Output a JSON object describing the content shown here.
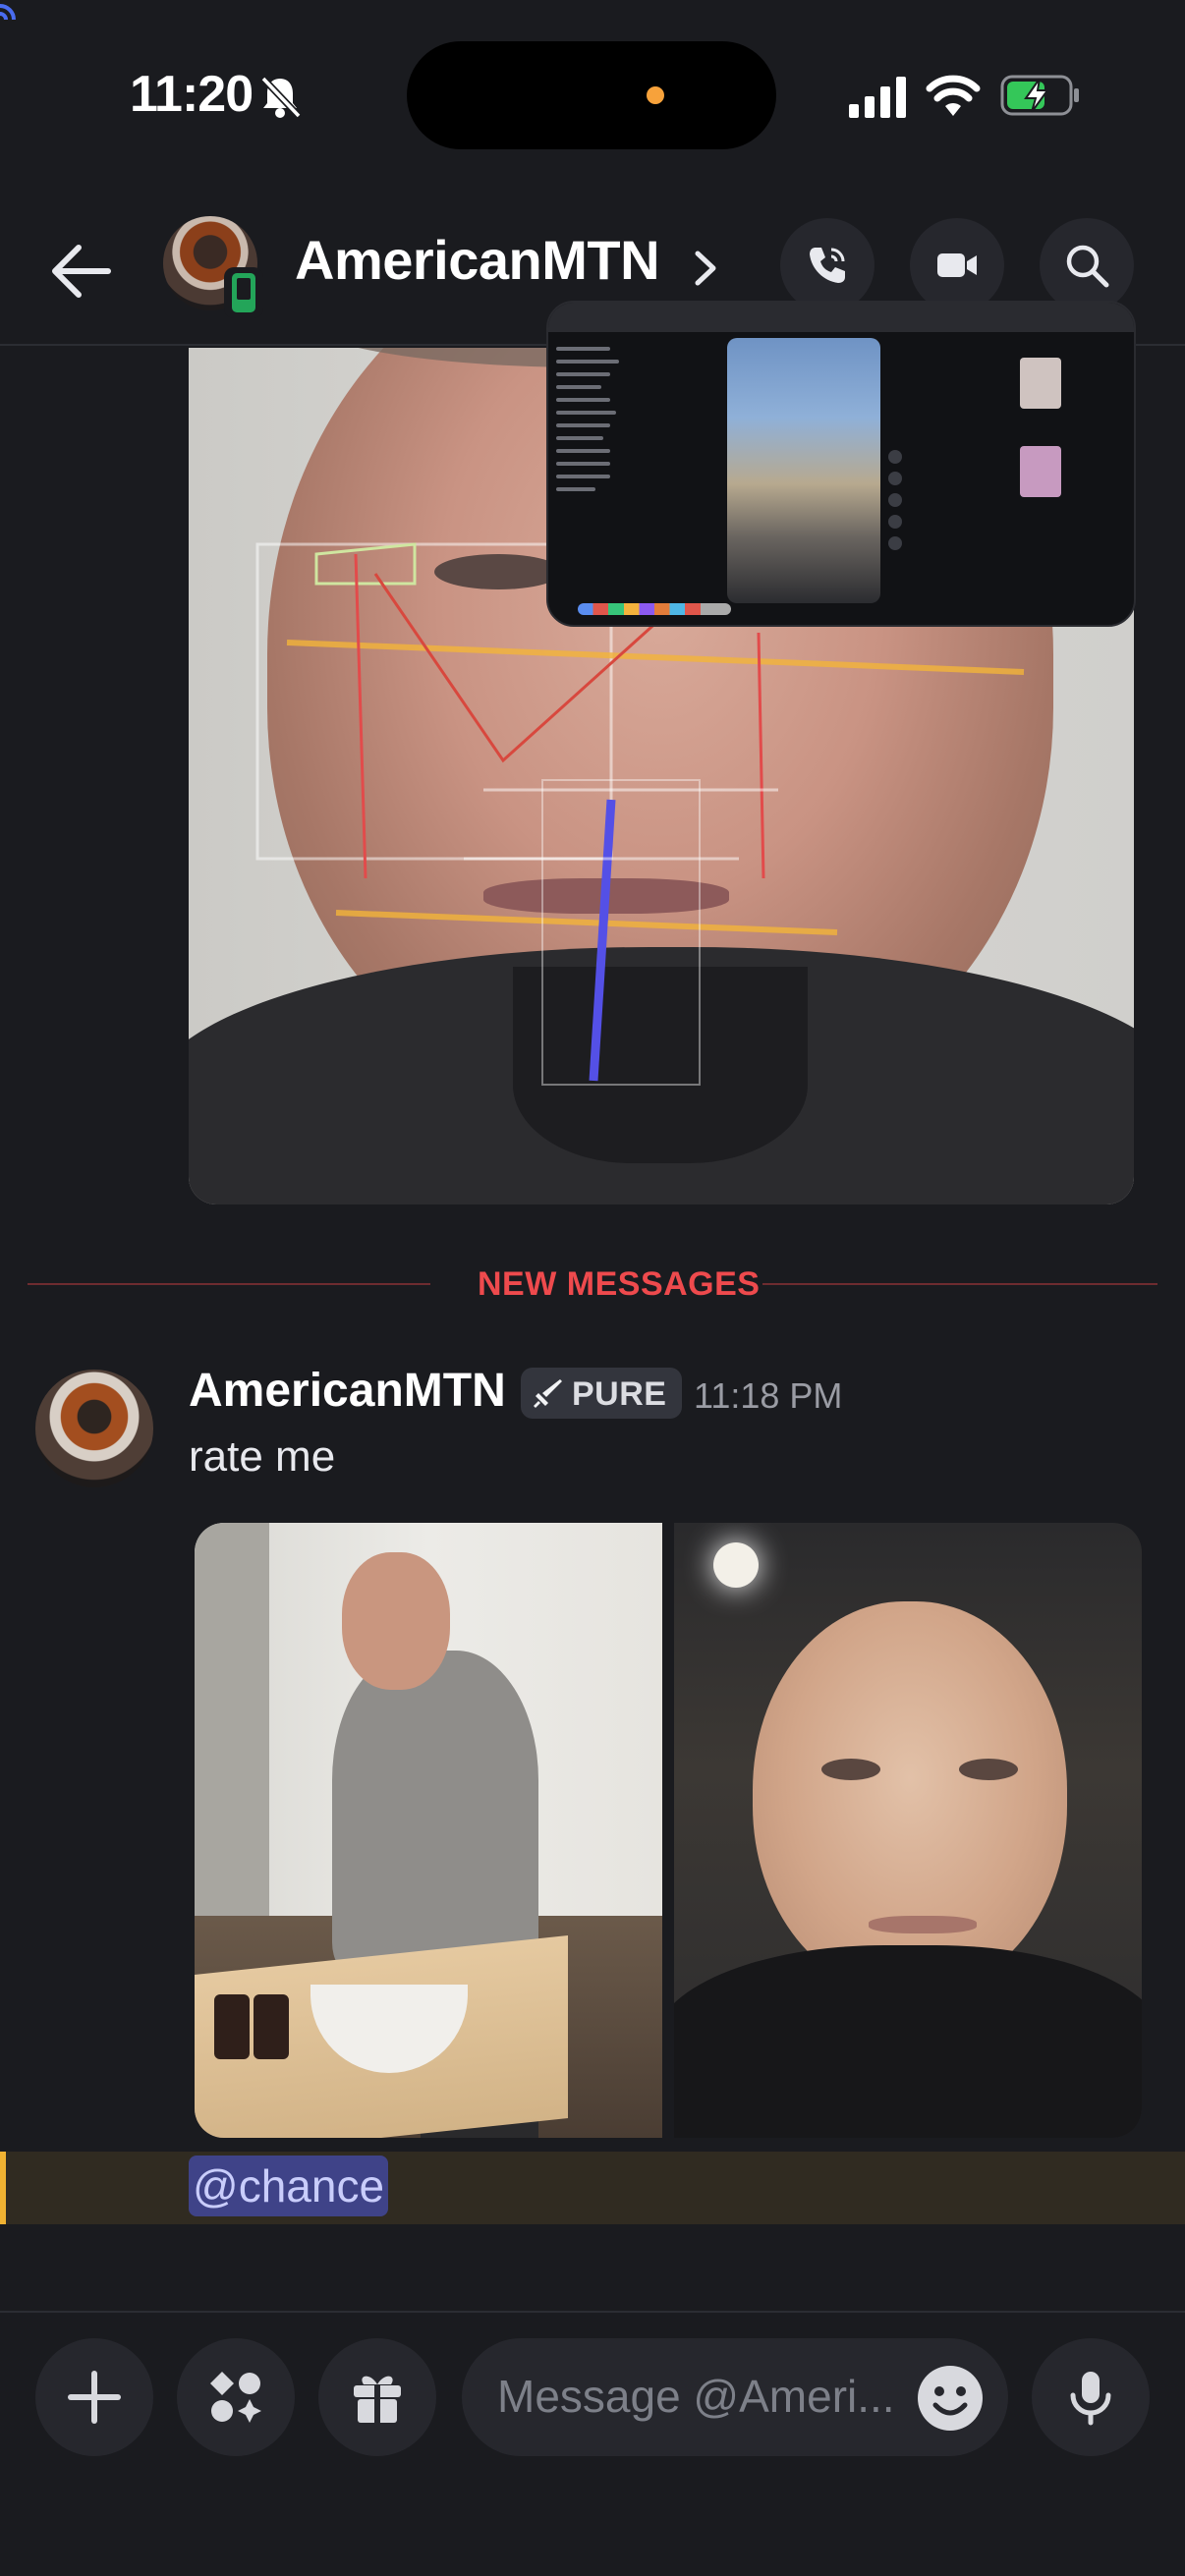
{
  "status_bar": {
    "time": "11:20",
    "icons": [
      "bell-muted-icon",
      "signal-icon",
      "wifi-icon",
      "battery-charging-icon"
    ]
  },
  "header": {
    "title": "AmericanMTN",
    "icons": [
      "back-arrow-icon",
      "chevron-right-icon",
      "voice-call-icon",
      "video-call-icon",
      "search-icon"
    ]
  },
  "divider": {
    "label": "NEW MESSAGES",
    "color": "#ee4a4d"
  },
  "message": {
    "author": "AmericanMTN",
    "tag": "PURE",
    "tag_icon": "sword-icon",
    "timestamp": "11:18 PM",
    "text": "rate me",
    "attachments_count": 2
  },
  "mention": {
    "text": "@chance",
    "highlight_color": "#f0b232"
  },
  "composer": {
    "placeholder": "Message @Ameri...",
    "icons": [
      "plus-icon",
      "apps-icon",
      "gift-icon",
      "emoji-icon",
      "microphone-icon"
    ]
  },
  "colors": {
    "background": "#1a1b1f",
    "accent_green": "#23a559",
    "mention_bg": "#3f4388"
  }
}
